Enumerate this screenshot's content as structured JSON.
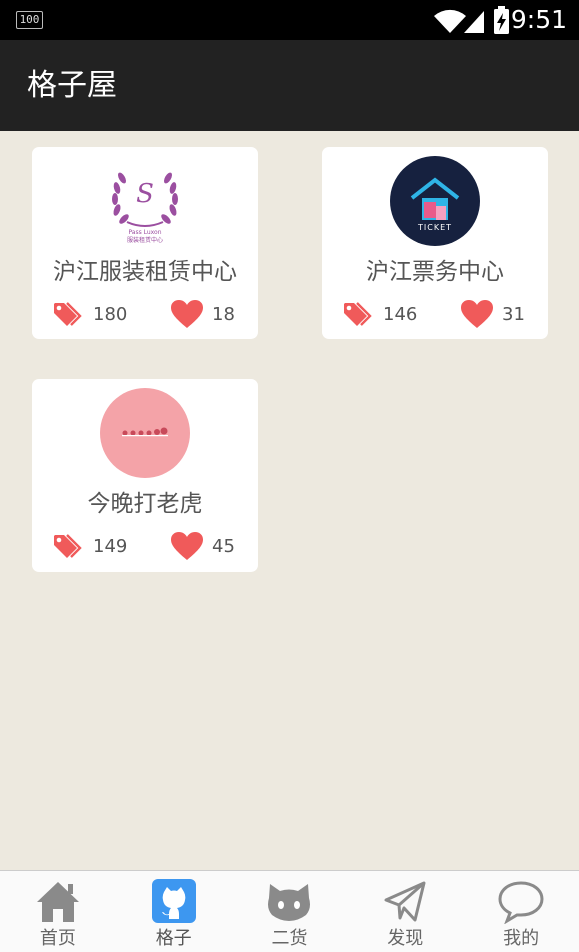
{
  "status_bar": {
    "battery_text": "100",
    "time": "9:51"
  },
  "app_bar": {
    "title": "格子屋"
  },
  "cards": [
    {
      "name": "沪江服装租赁中心",
      "tags": "180",
      "likes": "18"
    },
    {
      "name": "沪江票务中心",
      "tags": "146",
      "likes": "31"
    },
    {
      "name": "今晚打老虎",
      "tags": "149",
      "likes": "45"
    }
  ],
  "logo_text": {
    "ticket": "TICKET",
    "brand_small": "Pass Luxon",
    "brand_sub": "服装租赁中心"
  },
  "bottom_nav": [
    {
      "label": "首页",
      "icon": "home-icon"
    },
    {
      "label": "格子",
      "icon": "github-cat-icon",
      "active": true
    },
    {
      "label": "二货",
      "icon": "cat-face-icon"
    },
    {
      "label": "发现",
      "icon": "paper-plane-icon"
    },
    {
      "label": "我的",
      "icon": "chat-bubble-icon"
    }
  ],
  "colors": {
    "background": "#ede9df",
    "app_bar": "#222222",
    "accent": "#3d97f0",
    "tag": "#f05a5a",
    "heart": "#f05a5a",
    "nav_icon": "#888888"
  }
}
